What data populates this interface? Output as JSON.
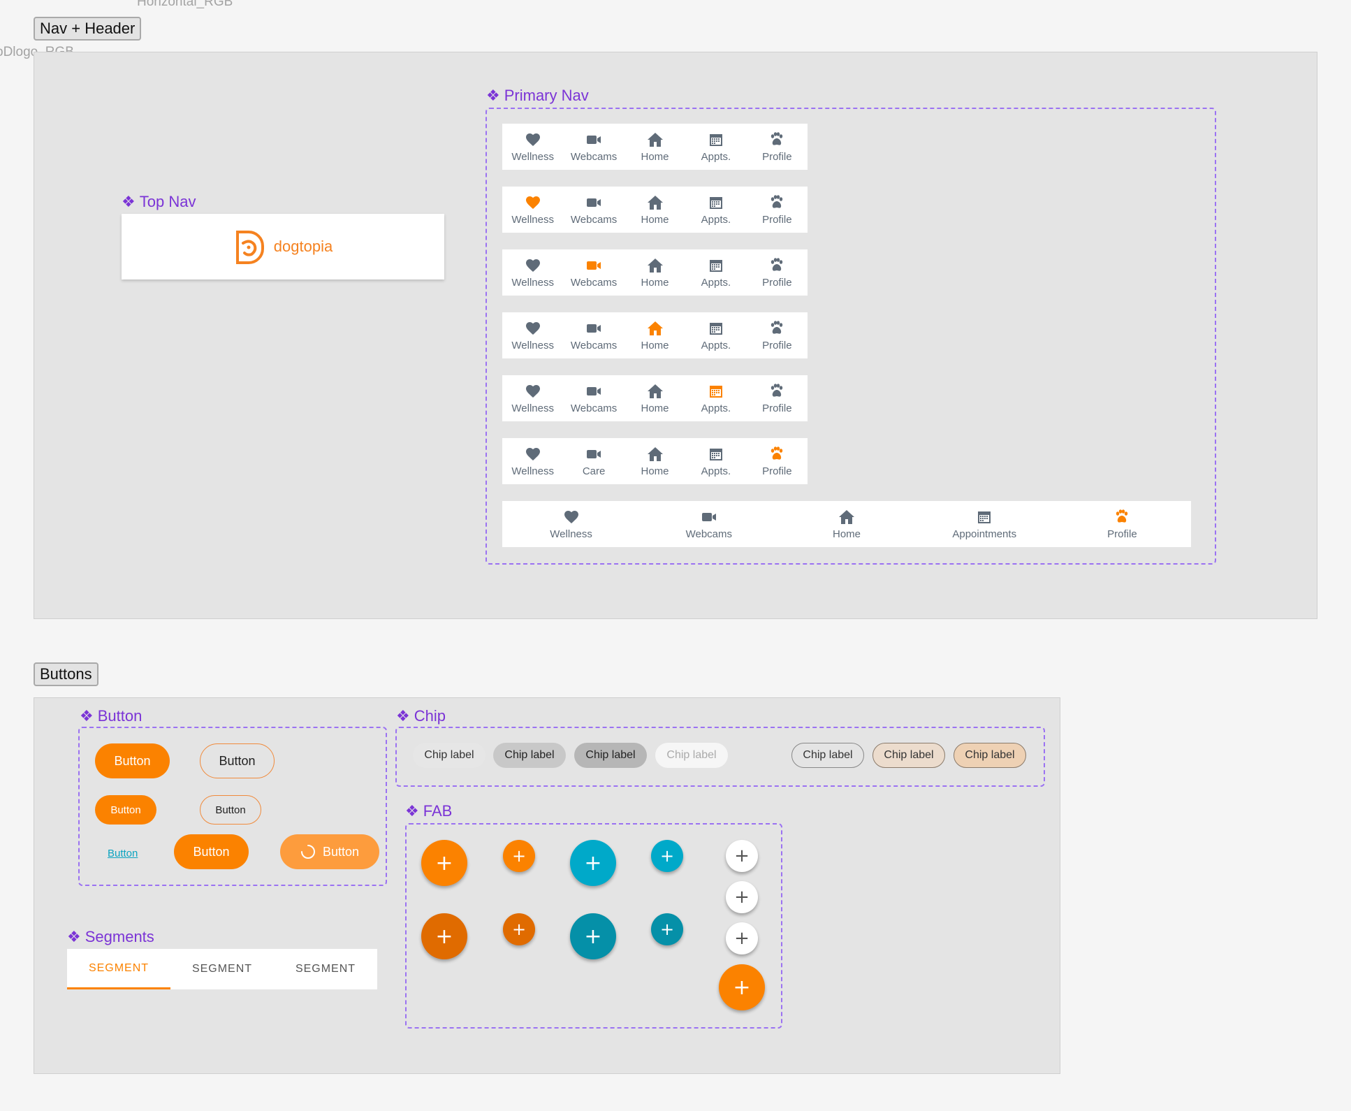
{
  "canvas_labels": {
    "horizontal_rgb": "Horizontal_RGB",
    "dlogo_rgb": "oDlogo_RGB"
  },
  "frames": {
    "nav_header": "Nav + Header",
    "buttons": "Buttons"
  },
  "components": {
    "primary_nav": "Primary Nav",
    "top_nav": "Top Nav",
    "button": "Button",
    "chip": "Chip",
    "fab": "FAB",
    "segments": "Segments"
  },
  "top_nav": {
    "brand": "dogtopia"
  },
  "colors": {
    "accent": "#fb8200",
    "icon": "#5f6b78",
    "teal": "#00a6c2",
    "purple": "#7b34d6"
  },
  "nav_rows": [
    {
      "active": -1,
      "items": [
        "Wellness",
        "Webcams",
        "Home",
        "Appts.",
        "Profile"
      ]
    },
    {
      "active": 0,
      "items": [
        "Wellness",
        "Webcams",
        "Home",
        "Appts.",
        "Profile"
      ]
    },
    {
      "active": 1,
      "items": [
        "Wellness",
        "Webcams",
        "Home",
        "Appts.",
        "Profile"
      ]
    },
    {
      "active": 2,
      "items": [
        "Wellness",
        "Webcams",
        "Home",
        "Appts.",
        "Profile"
      ]
    },
    {
      "active": 3,
      "items": [
        "Wellness",
        "Webcams",
        "Home",
        "Appts.",
        "Profile"
      ]
    },
    {
      "active": 4,
      "items": [
        "Wellness",
        "Care",
        "Home",
        "Appts.",
        "Profile"
      ]
    }
  ],
  "nav_wide": {
    "active": 4,
    "items": [
      "Wellness",
      "Webcams",
      "Home",
      "Appointments",
      "Profile"
    ]
  },
  "nav_icons": [
    "heart-icon",
    "video-camera-icon",
    "home-icon",
    "calendar-icon",
    "paw-icon"
  ],
  "buttons": {
    "large_filled": "Button",
    "large_outline": "Button",
    "small_filled": "Button",
    "small_outline": "Button",
    "link": "Button",
    "medium_filled": "Button",
    "loading": "Button"
  },
  "chips": {
    "default": "Chip label",
    "hover": "Chip label",
    "pressed": "Chip label",
    "disabled": "Chip label",
    "outline": "Chip label",
    "outline_tinted": "Chip label",
    "outline_selected": "Chip label"
  },
  "fab": {
    "icon": "+"
  },
  "segments": {
    "items": [
      "SEGMENT",
      "SEGMENT",
      "SEGMENT"
    ],
    "active": 0
  }
}
